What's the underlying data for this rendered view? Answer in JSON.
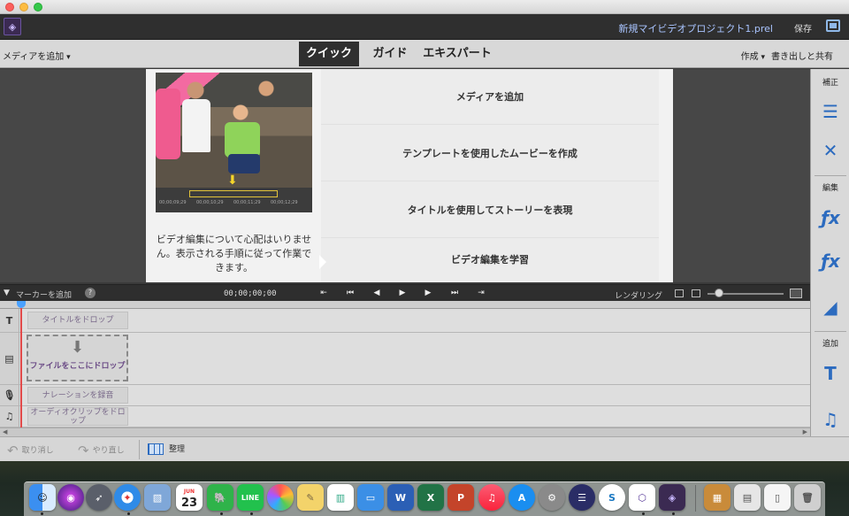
{
  "app": {
    "project_title": "新規マイビデオプロジェクト1.prel",
    "save_label": "保存"
  },
  "modebar": {
    "add_media": "メディアを追加",
    "tabs": [
      "クイック",
      "ガイド",
      "エキスパート"
    ],
    "create": "作成",
    "export_share": "書き出しと共有"
  },
  "welcome": {
    "tip": "ビデオ編集について心配はいりません。表示される手順に従って作業できます。",
    "actions": [
      "メディアを追加",
      "テンプレートを使用したムービーを作成",
      "タイトルを使用してストーリーを表現",
      "ビデオ編集を学習"
    ],
    "photo_timecodes": [
      "00;00;09;29",
      "00;00;10;29",
      "00;00;11;29",
      "00;00;12;29"
    ]
  },
  "right_panel": {
    "section_adjust": "補正",
    "section_edit": "編集",
    "section_add": "追加"
  },
  "timeline": {
    "add_marker": "マーカーを追加",
    "help": "?",
    "timecode": "00;00;00;00",
    "render": "レンダリング",
    "tracks": {
      "title_drop": "タイトルをドロップ",
      "file_drop": "ファイルをここにドロップ",
      "narration": "ナレーションを録音",
      "audio_drop": "オーディオクリップをドロップ"
    }
  },
  "bottombar": {
    "undo": "取り消し",
    "redo": "やり直し",
    "organize": "整理"
  },
  "dock": {
    "calendar_day": "23",
    "calendar_month": "JUN",
    "line_label": "LINE"
  }
}
